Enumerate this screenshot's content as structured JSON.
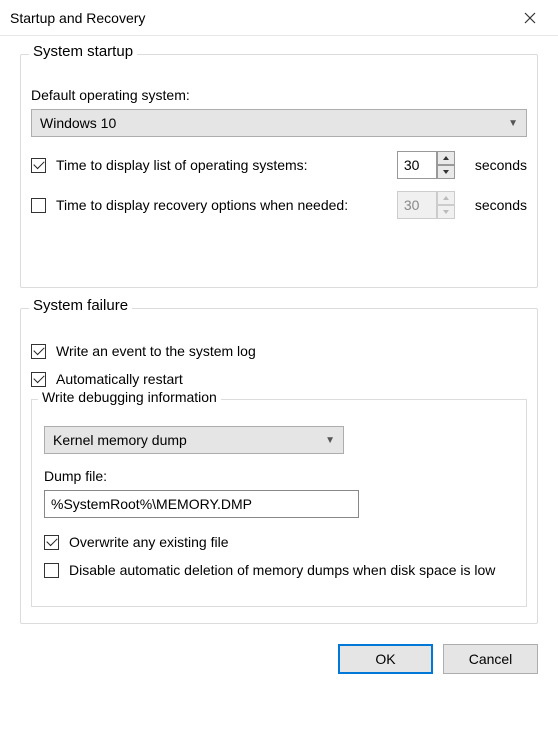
{
  "window": {
    "title": "Startup and Recovery"
  },
  "startup": {
    "group_title": "System startup",
    "default_os_label": "Default operating system:",
    "default_os_value": "Windows 10",
    "display_os_list_label": "Time to display list of operating systems:",
    "display_os_list_checked": true,
    "display_os_list_value": "30",
    "display_recovery_label": "Time to display recovery options when needed:",
    "display_recovery_checked": false,
    "display_recovery_value": "30",
    "seconds_label": "seconds"
  },
  "failure": {
    "group_title": "System failure",
    "write_event_label": "Write an event to the system log",
    "write_event_checked": true,
    "auto_restart_label": "Automatically restart",
    "auto_restart_checked": true,
    "debug_title": "Write debugging information",
    "debug_type_value": "Kernel memory dump",
    "dump_file_label": "Dump file:",
    "dump_file_value": "%SystemRoot%\\MEMORY.DMP",
    "overwrite_label": "Overwrite any existing file",
    "overwrite_checked": true,
    "disable_auto_delete_label": "Disable automatic deletion of memory dumps when disk space is low",
    "disable_auto_delete_checked": false
  },
  "buttons": {
    "ok": "OK",
    "cancel": "Cancel"
  }
}
